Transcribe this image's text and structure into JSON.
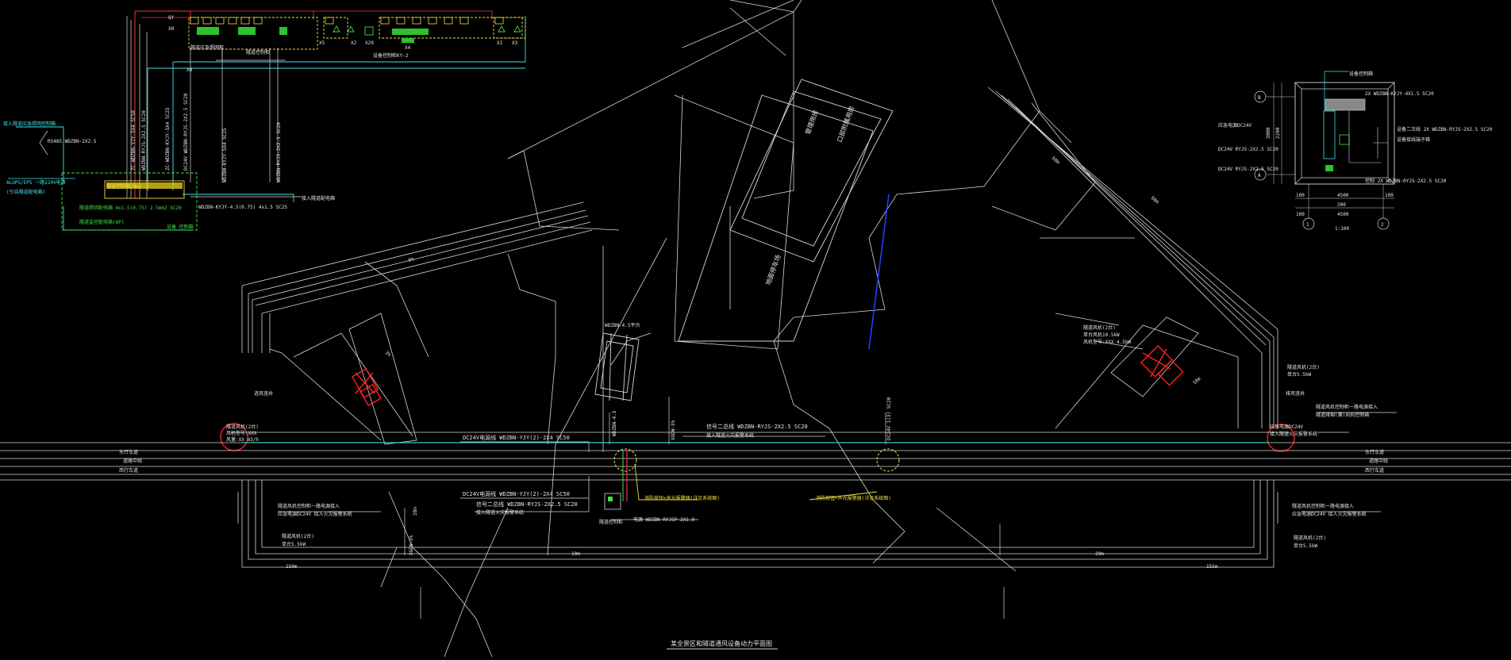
{
  "drawing": {
    "title": "某全景区和隧道通风设备动力平面图"
  },
  "schematic": {
    "labels": {
      "qy": "QY",
      "xh": "XH",
      "xh_mid": "XH",
      "x1": "X1",
      "x2": "X2",
      "x5": "X5",
      "x29": "X29",
      "x3": "X3",
      "x4": "X4",
      "sub_caption_1": "隧道应急照明柜",
      "sub_caption_2": "隧道控制柜",
      "sub_caption_3": "设备控制柜KY-2"
    },
    "cables": [
      "ZC-WDZBN-YJY-5X4 SC50",
      "WDZBN-RYJS-2X2.5 SC20",
      "ZC-WDZBN-KYJY-5X4 SC25",
      "DC24V WDZBN-RYJS-2X2.5 SC20",
      "WDZBN-KYJY-5X4 SC25",
      "WDZBN-RYJS-2X2.5 SC20"
    ],
    "bottom_cable": "WDZBN-KYJY-4.5(0.75) 4x1.5 SC25",
    "left_notes": [
      "接入隧道应急照明控制箱",
      "RS485 WDZBN-2X2.5",
      "ALUPS/EPS 一路220V电源",
      "(引自隧道配电箱)"
    ],
    "box_label": "隧道控制箱(Mm)",
    "box_lines": [
      "隧道照明配电箱 4x1.5(0.75) 2.5mm2 SC20",
      "隧道监控配电箱(AP)",
      "设备  控制箱"
    ],
    "right_note": "接入隧道配电箱"
  },
  "detail_plan": {
    "axes": [
      "B",
      "A",
      "1",
      "2"
    ],
    "dims": [
      "100",
      "4500",
      "100",
      "200",
      "4500",
      "100",
      "3000",
      "2200"
    ],
    "notes": [
      "设备控制箱",
      "2X WDZBN-KYJY-4X1.5 SC20",
      "应急电源DC24V",
      "DC24V RYJS-2X2.5 SC20",
      "设备二次线 2X WDZBN-RYJS-2X2.5 SC20",
      "设备接线端子箱",
      "DC24V RYJS-2X2.5 SC20",
      "控制 2X WDZBN-RYJS-2X2.5 SC20"
    ],
    "caption": "1:100"
  },
  "plan": {
    "building_label_1": "管理用房",
    "building_label_2": "口部附属用房",
    "building_label_3": "地面停车场",
    "plaque": "WDZBN-4.5平台",
    "duct_labels": [
      "进风竖井",
      "排风竖井"
    ],
    "fan_left": [
      "隧道风机(2台)",
      "风机型号:XXX",
      "风量:XX m3/h"
    ],
    "fan_right": [
      "隧道风机(2台)",
      "单台风机10.5kW",
      "风机型号:XXX 4.5kW"
    ],
    "right_notes": [
      "隧道风机(2台)",
      "单台5.5kW",
      "隧道风机控制柜一路电源接入",
      "隧道排烟(兼)风机控制箱",
      "应急电源DC24V",
      "接入隧道火灾报警系统"
    ],
    "left_bottom_notes": [
      "隧道风机控制柜一路电源接入",
      "应急电源DC24V 接入火灾报警系统",
      "隧道风机(2台)",
      "单台5.5kW"
    ],
    "right_bottom_notes": [
      "隧道风机控制柜一路电源接入",
      "应急电源DC24V 接入火灾报警系统",
      "隧道风机(2台)",
      "单台5.5kW"
    ],
    "road_labels_left": [
      "东行车道",
      "道路中线",
      "西行车道"
    ],
    "road_labels_right": [
      "东行车道",
      "道路中线",
      "西行车道"
    ],
    "cable_a": "DC24V电源线 WDZBN-YJY(2)-2X4 SC50",
    "cable_b": "信号二总线 WDZBN-RYJS-2X2.5 SC20",
    "cable_b2": "接入隧道火灾报警系统",
    "cable_c": "DC24V电源线 WDZBN-YJY(2)-2X4 SC50",
    "cable_d": "信号二总线 WDZBN-RYJS-2X2.5 SC20",
    "cable_d2": "接入隧道火灾报警系统",
    "cable_e": "电源 WDZBN-RYJSP-2X1.0",
    "yellow_label_1": "消防按钮+声光报警器(详见系统图)",
    "yellow_label_2": "消防按钮+声光报警器(详见系统图)",
    "small_box_label": "隧道控制柜",
    "vertical_tags": [
      "WDZBN-4.5",
      "XGDW-5%",
      "DC24V 1(3) SC20",
      "XGDW-5%"
    ],
    "dim_texts": [
      "6%",
      "60m",
      "60m",
      "3%",
      "10m",
      "28m",
      "10m",
      "20m",
      "150m",
      "155m"
    ]
  }
}
